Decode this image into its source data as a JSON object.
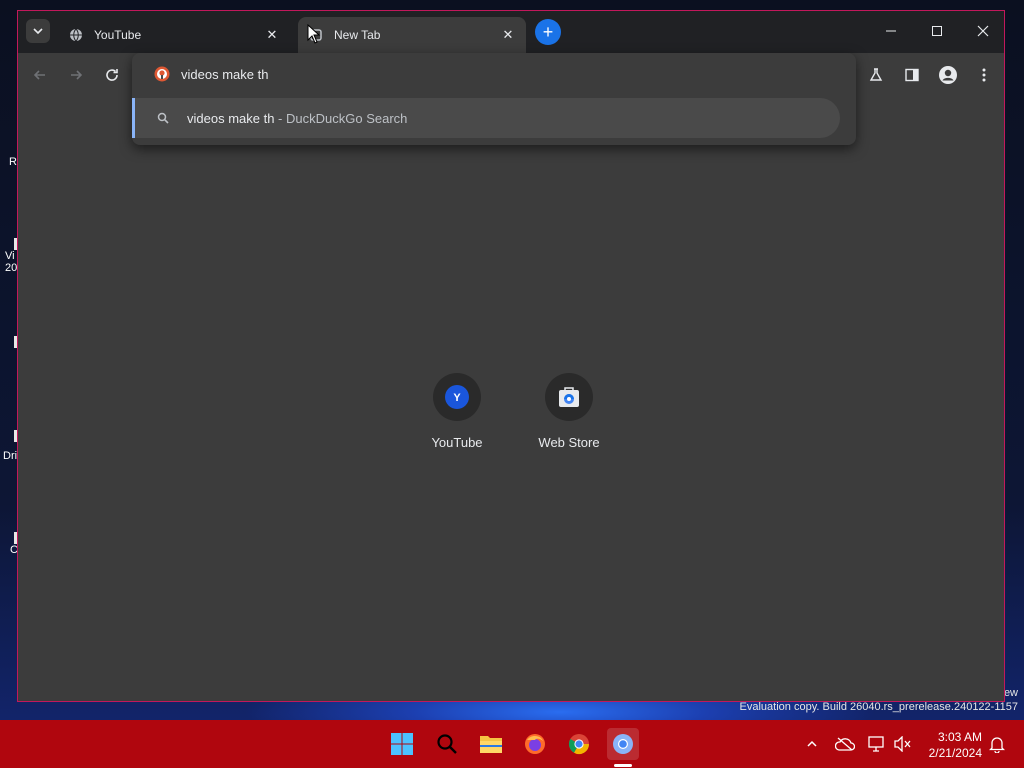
{
  "browser": {
    "tabs": [
      {
        "title": "YouTube",
        "active": false
      },
      {
        "title": "New Tab",
        "active": true
      }
    ],
    "omnibox": {
      "value": "videos make th",
      "suggestion_query": "videos make th",
      "suggestion_separator": " - ",
      "suggestion_provider": "DuckDuckGo Search"
    },
    "shortcuts": [
      {
        "label": "YouTube",
        "letter": "Y"
      },
      {
        "label": "Web Store"
      }
    ]
  },
  "desktop": {
    "icon_fragments": [
      "R",
      "Vi",
      "20",
      "Dri",
      "C"
    ],
    "watermark_line1": "ew",
    "watermark_line2": "Evaluation copy. Build 26040.rs_prerelease.240122-1157"
  },
  "taskbar": {
    "time": "3:03 AM",
    "date": "2/21/2024"
  },
  "colors": {
    "window_bg": "#3c3c3c",
    "tabstrip_bg": "#202124",
    "accent": "#1a73e8",
    "taskbar_bg": "#b0060e"
  }
}
